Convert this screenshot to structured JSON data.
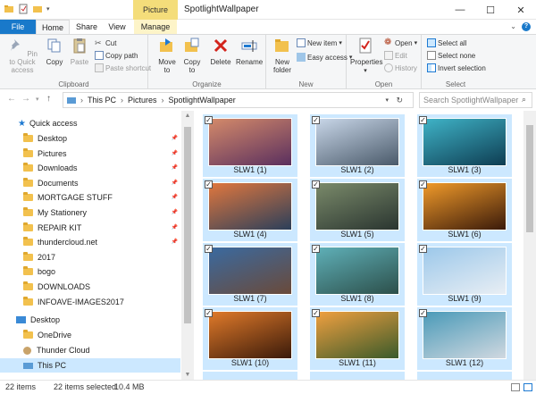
{
  "titlebar": {
    "picture_tools": "Picture Tools",
    "title": "SpotlightWallpaper",
    "minimize": "—",
    "maximize": "☐",
    "close": "✕"
  },
  "tabs": {
    "file": "File",
    "home": "Home",
    "share": "Share",
    "view": "View",
    "manage": "Manage"
  },
  "ribbon": {
    "clipboard": {
      "name": "Clipboard",
      "pin": "Pin to Quick access",
      "copy": "Copy",
      "paste": "Paste",
      "cut": "Cut",
      "copy_path": "Copy path",
      "paste_shortcut": "Paste shortcut"
    },
    "organize": {
      "name": "Organize",
      "move_to": "Move to",
      "copy_to": "Copy to",
      "delete": "Delete",
      "rename": "Rename"
    },
    "new": {
      "name": "New",
      "new_folder": "New folder",
      "new_item": "New item",
      "easy_access": "Easy access"
    },
    "open": {
      "name": "Open",
      "properties": "Properties",
      "open": "Open",
      "edit": "Edit",
      "history": "History"
    },
    "select": {
      "name": "Select",
      "select_all": "Select all",
      "select_none": "Select none",
      "invert": "Invert selection"
    }
  },
  "address": {
    "crumbs": [
      "This PC",
      "Pictures",
      "SpotlightWallpaper"
    ],
    "search_placeholder": "Search SpotlightWallpaper"
  },
  "nav": {
    "quick_access": "Quick access",
    "items": [
      {
        "label": "Desktop",
        "pinned": true
      },
      {
        "label": "Pictures",
        "pinned": true
      },
      {
        "label": "Downloads",
        "pinned": true
      },
      {
        "label": "Documents",
        "pinned": true
      },
      {
        "label": "MORTGAGE STUFF",
        "pinned": true
      },
      {
        "label": "My Stationery",
        "pinned": true
      },
      {
        "label": "REPAIR KIT",
        "pinned": true
      },
      {
        "label": "thundercloud.net",
        "pinned": true
      },
      {
        "label": "2017",
        "pinned": false
      },
      {
        "label": "bogo",
        "pinned": false
      },
      {
        "label": "DOWNLOADS",
        "pinned": false
      },
      {
        "label": "INFOAVE-IMAGES2017",
        "pinned": false
      }
    ],
    "desktop": "Desktop",
    "onedrive": "OneDrive",
    "thunder_cloud": "Thunder Cloud",
    "this_pc": "This PC"
  },
  "files": [
    {
      "label": "SLW1 (1)",
      "c1": "#d48a6a",
      "c2": "#5a2f5e"
    },
    {
      "label": "SLW1 (2)",
      "c1": "#c8d6e8",
      "c2": "#4a5a6a"
    },
    {
      "label": "SLW1 (3)",
      "c1": "#3fb3c7",
      "c2": "#0e3d52"
    },
    {
      "label": "SLW1 (4)",
      "c1": "#e0773e",
      "c2": "#2b3f5a"
    },
    {
      "label": "SLW1 (5)",
      "c1": "#7a8a6a",
      "c2": "#2a3530"
    },
    {
      "label": "SLW1 (6)",
      "c1": "#f09a2a",
      "c2": "#3a1a0a"
    },
    {
      "label": "SLW1 (7)",
      "c1": "#3a6aa0",
      "c2": "#6a4a3a"
    },
    {
      "label": "SLW1 (8)",
      "c1": "#5fb0b8",
      "c2": "#2c4f4a"
    },
    {
      "label": "SLW1 (9)",
      "c1": "#9cc8ea",
      "c2": "#e8eef4"
    },
    {
      "label": "SLW1 (10)",
      "c1": "#e07a2a",
      "c2": "#3a1a0a"
    },
    {
      "label": "SLW1 (11)",
      "c1": "#f0a040",
      "c2": "#3a5a2a"
    },
    {
      "label": "SLW1 (12)",
      "c1": "#4a9ab8",
      "c2": "#d0d8e0"
    }
  ],
  "status": {
    "count": "22 items",
    "selected": "22 items selected",
    "size": "10.4 MB"
  }
}
